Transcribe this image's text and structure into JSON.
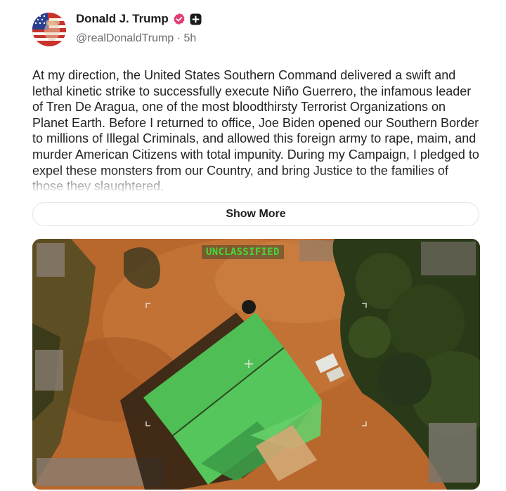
{
  "author": {
    "display_name": "Donald J. Trump",
    "handle": "@realDonaldTrump",
    "separator": "·",
    "timestamp": "5h",
    "badges": [
      "verified-badge-icon",
      "plus-badge-icon"
    ],
    "verified_color": "#e23c74"
  },
  "post": {
    "text": "At my direction, the United States Southern Command delivered a swift and lethal kinetic strike to successfully execute Niño Guerrero, the infamous leader of Tren De Aragua, one of the most bloodthirsty Terrorist Organizations on Planet Earth. Before I returned to office, Joe Biden opened our Southern Border to millions of Illegal Criminals, and allowed this foreign army to rape, maim, and murder American Citizens with total impunity. During my Campaign, I pledged to expel these monsters from our Country, and bring Justice to the families of those they slaughtered.",
    "show_more_label": "Show More"
  },
  "media": {
    "overlay_label": "UNCLASSIFIED",
    "overlay_color": "#46d63c",
    "icon": "aerial-drone-footage"
  }
}
